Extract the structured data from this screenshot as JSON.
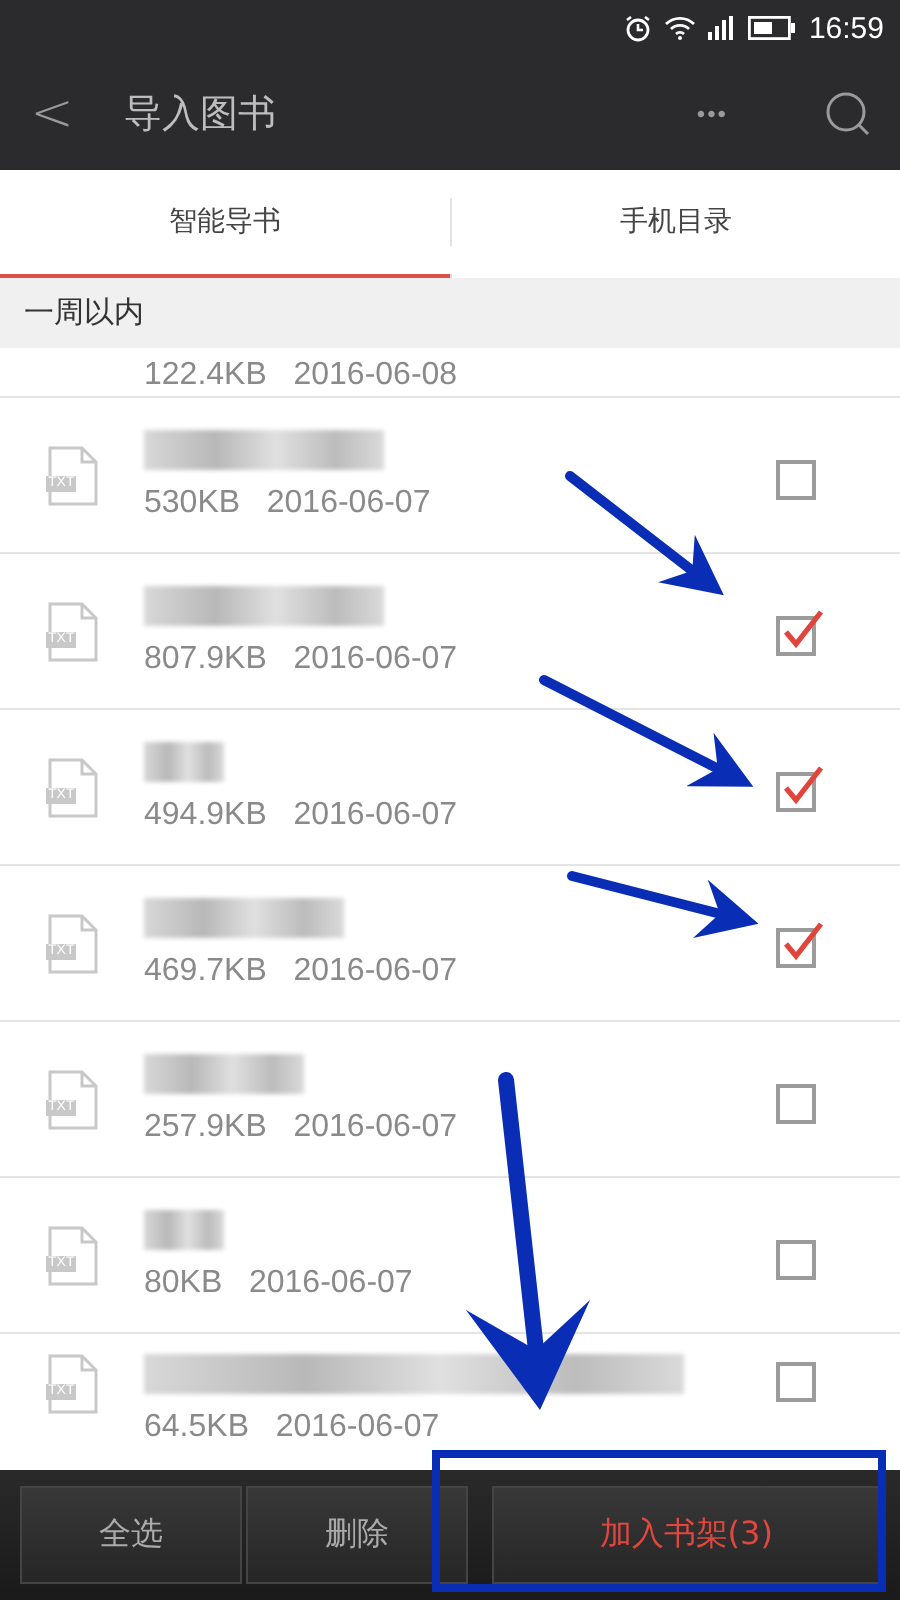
{
  "status_bar": {
    "time": "16:59"
  },
  "header": {
    "back": "<",
    "title": "导入图书",
    "more": "•••"
  },
  "tabs": [
    {
      "label": "智能导书",
      "selected": true
    },
    {
      "label": "手机目录",
      "selected": false
    }
  ],
  "section": {
    "title": "一周以内"
  },
  "partial_row": {
    "size": "122.4KB",
    "date": "2016-06-08"
  },
  "files": [
    {
      "type": "TXT",
      "size": "530KB",
      "date": "2016-06-07",
      "checked": false
    },
    {
      "type": "TXT",
      "size": "807.9KB",
      "date": "2016-06-07",
      "checked": true
    },
    {
      "type": "TXT",
      "size": "494.9KB",
      "date": "2016-06-07",
      "checked": true
    },
    {
      "type": "TXT",
      "size": "469.7KB",
      "date": "2016-06-07",
      "checked": true
    },
    {
      "type": "TXT",
      "size": "257.9KB",
      "date": "2016-06-07",
      "checked": false
    },
    {
      "type": "TXT",
      "size": "80KB",
      "date": "2016-06-07",
      "checked": false
    },
    {
      "type": "TXT",
      "size": "64.5KB",
      "date": "2016-06-07",
      "checked": false
    }
  ],
  "toolbar": [
    {
      "label": "全选",
      "kind": "plain"
    },
    {
      "label": "删除",
      "kind": "plain"
    },
    {
      "label": "加入书架(3)",
      "kind": "primary"
    }
  ]
}
